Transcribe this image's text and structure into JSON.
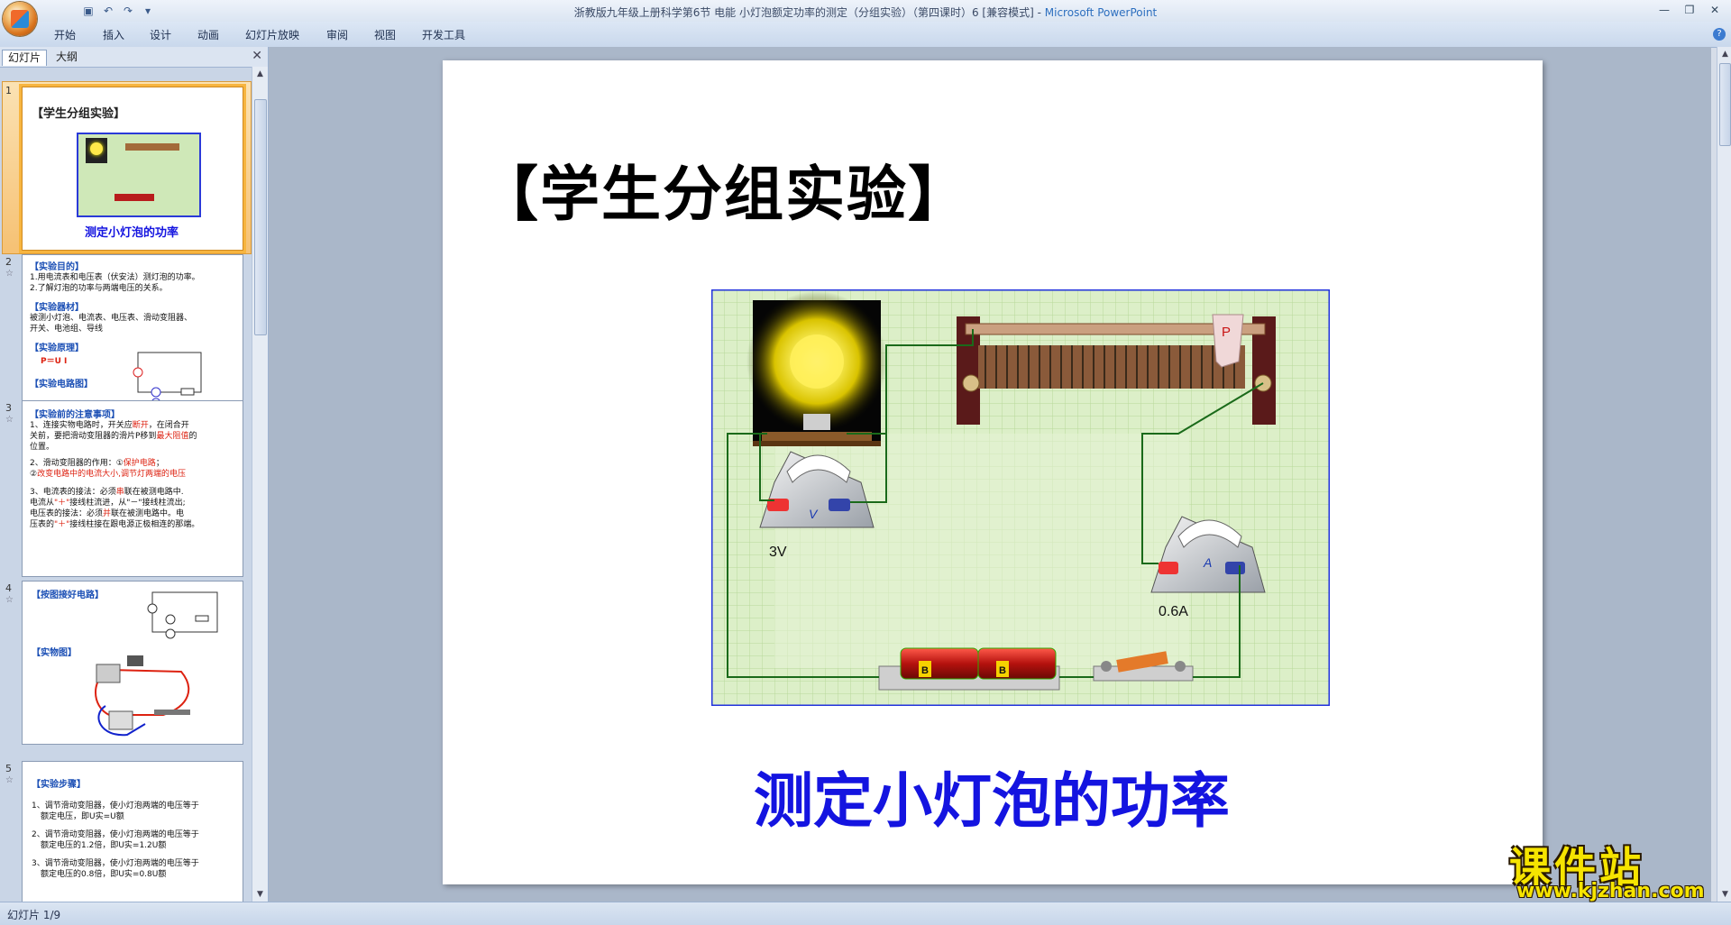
{
  "window": {
    "title": "浙教版九年级上册科学第6节 电能 小灯泡额定功率的测定（分组实验）（第四课时）6 [兼容模式] - ",
    "app_name": "Microsoft PowerPoint"
  },
  "ribbon": {
    "tabs": [
      "开始",
      "插入",
      "设计",
      "动画",
      "幻灯片放映",
      "审阅",
      "视图",
      "开发工具"
    ]
  },
  "left_panel": {
    "tabs": [
      "幻灯片",
      "大纲"
    ],
    "thumbnails": [
      {
        "num": "1",
        "title": "【学生分组实验】",
        "caption": "测定小灯泡的功率"
      },
      {
        "num": "2",
        "lines": [
          {
            "head": "【实验目的】"
          },
          {
            "text": "1.用电流表和电压表（伏安法）测灯泡的功率。"
          },
          {
            "text": "2.了解灯泡的功率与两端电压的关系。"
          },
          {
            "head": "【实验器材】"
          },
          {
            "text": "被测小灯泡、电流表、电压表、滑动变阻器、"
          },
          {
            "text": "开关、电池组、导线"
          },
          {
            "head": "【实验原理】"
          },
          {
            "formula": "P＝U I"
          },
          {
            "head": "【实验电路图】"
          }
        ]
      },
      {
        "num": "3",
        "lines": [
          {
            "head": "【实验前的注意事项】"
          },
          {
            "text": "1、连接实物电路时，开关应",
            "fill": "断开",
            "after": "，在闭合开"
          },
          {
            "text": "关前，要把滑动变阻器的滑片P移到",
            "fill": "最大阻值",
            "after": "的"
          },
          {
            "text": "位置。"
          },
          {
            "text": "2、滑动变阻器的作用：①",
            "fill": "保护电路",
            "after": "；"
          },
          {
            "text": "②",
            "fill": "改变电路中的电流大小,调节灯两端的电压",
            "after": ""
          },
          {
            "text": "3、电流表的接法：必须",
            "fill": "串",
            "after": "联在被测电路中."
          },
          {
            "text": "电流从",
            "fill": "\"＋\"",
            "after": "接线柱流进，从\"－\"接线柱流出;"
          },
          {
            "text": "电压表的接法：必须",
            "fill": "并",
            "after": "联在被测电路中。电"
          },
          {
            "text": "压表的",
            "fill": "\"＋\"",
            "after": "接线柱接在跟电源正极相连的那端。"
          }
        ]
      },
      {
        "num": "4",
        "lines": [
          {
            "head": "【按图接好电路】"
          },
          {
            "head": "【实物图】"
          }
        ]
      },
      {
        "num": "5",
        "lines": [
          {
            "head": "【实验步骤】"
          },
          {
            "text": "1、调节滑动变阻器，使小灯泡两端的电压等于"
          },
          {
            "text": "额定电压，即U实=U额"
          },
          {
            "text": "2、调节滑动变阻器，使小灯泡两端的电压等于"
          },
          {
            "text": "额定电压的1.2倍，即U实=1.2U额"
          },
          {
            "text": "3、调节滑动变阻器，使小灯泡两端的电压等于"
          },
          {
            "text": "额定电压的0.8倍，即U实=0.8U额"
          }
        ]
      }
    ]
  },
  "slide": {
    "title": "【学生分组实验】",
    "subtitle": "测定小灯泡的功率",
    "circuit": {
      "voltmeter_label": "3V",
      "ammeter_label": "0.6A",
      "rheostat_label": "P",
      "voltmeter_symbol": "V",
      "ammeter_symbol": "A",
      "battery_text": "B"
    }
  },
  "status": {
    "slide_indicator": "幻灯片 1/9"
  },
  "watermark": {
    "main": "课件站",
    "url": "www.kjzhan.com"
  },
  "colors": {
    "title_blue": "#1414e0",
    "circuit_border": "#2233dd",
    "circuit_grid": "#cfe8b8",
    "wire": "#1a6a1a",
    "selection": "#f7b540"
  },
  "icons": {
    "office_button": "office-logo-icon",
    "save": "save-icon",
    "undo": "undo-icon",
    "redo": "redo-icon"
  }
}
